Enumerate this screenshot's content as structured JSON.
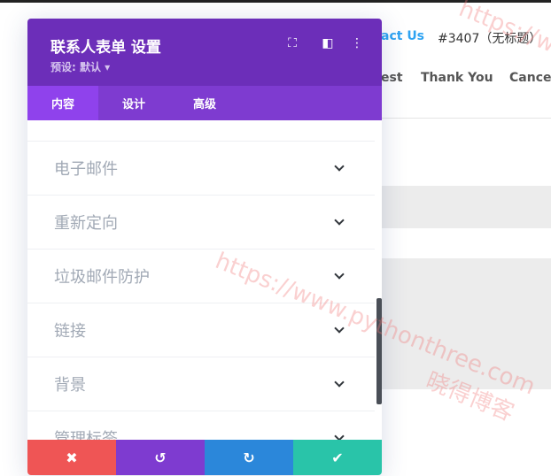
{
  "background": {
    "nav_contact": "act Us",
    "post_id": "#3407（无标题）",
    "nav_items": [
      "est",
      "Thank You",
      "Cancel"
    ]
  },
  "watermark": {
    "url": "https://www.pythonthree.com",
    "url_top": "https://w",
    "name": "晓得博客"
  },
  "panel": {
    "title": "联系人表单 设置",
    "preset": "预设: 默认 ▾",
    "header_icons": [
      "focus-icon",
      "sidebar-layout-icon",
      "more-vertical-icon"
    ],
    "tabs": [
      {
        "label": "内容",
        "active": true
      },
      {
        "label": "设计"
      },
      {
        "label": "高级"
      }
    ],
    "sections": [
      "电子邮件",
      "重新定向",
      "垃圾邮件防护",
      "链接",
      "背景",
      "管理标签"
    ],
    "footer": {
      "colors": {
        "cancel": "#ef5555",
        "undo": "#7e3bd0",
        "redo": "#2b87da",
        "save": "#29c4a9"
      }
    }
  }
}
